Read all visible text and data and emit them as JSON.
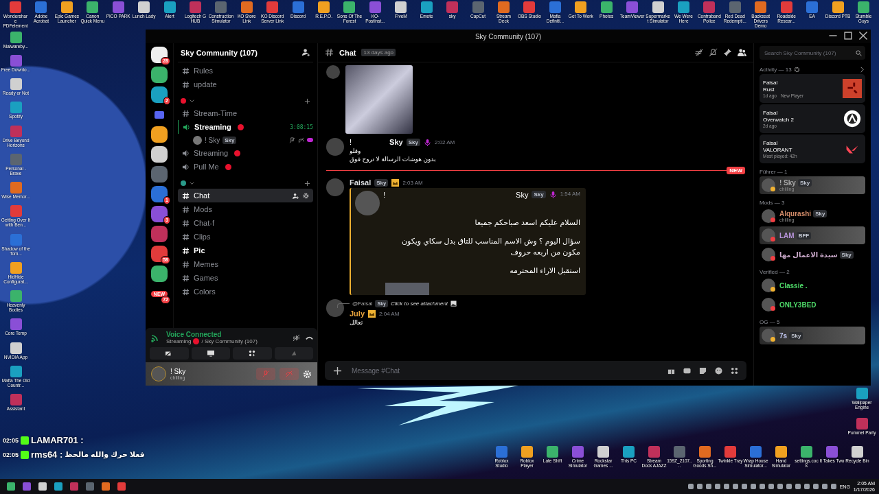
{
  "desktop": {
    "top_icons": [
      "Wondershare PDFelement",
      "Adobe Acrobat",
      "Epic Games Launcher",
      "Canon Quick Menu",
      "PICO PARK",
      "Lunch Lady",
      "Alert",
      "Logitech G HUB",
      "Construction Simulator",
      "KO Store Link",
      "KO Discord Server Link",
      "Discord",
      "R.E.P.O.",
      "Sons Of The Forest",
      "KO-Postinst...",
      "FiveM",
      "Emote",
      "sky",
      "CapCut",
      "Stream Deck",
      "OBS Studio",
      "Mafia Definiti...",
      "Get To Work",
      "Photos",
      "TeamViewer",
      "Supermarket Simulator",
      "We Were Here",
      "Contraband Police",
      "Red Dead Redempti...",
      "Backseat Drivers Demo",
      "Roadside Resear...",
      "EA",
      "Discord PTB",
      "Stumble Guys"
    ],
    "left_icons": [
      "Malwareby...",
      "Free Downlo...",
      "Ready or Not",
      "Spotify",
      "Drive Beyond Horizons",
      "Personal - Brave",
      "Wise Memor...",
      "Getting Over It with Ben...",
      "Shadow of the Tom...",
      "HidHide Configurat...",
      "Heavenly Bodies",
      "Core Temp",
      "NVIDIA App",
      "Mafia The Old Countr...",
      "Assistant"
    ],
    "right_icons": [
      "Wallpaper Engine",
      "Pummel Party"
    ],
    "bottom_icons": [
      "Roblox Studio",
      "Roblox Player",
      "Late Shift",
      "Crime Simulator",
      "Rockstar Games ...",
      "This PC",
      "Stream Dock AJAZZ",
      "159Z_2107....",
      "Sporting Goods Sh...",
      "Twinkle Tray",
      "Wrap House Simulator...",
      "Hand Simulator",
      "settings.cock",
      "It Takes Two",
      "Recycle Bin"
    ]
  },
  "stream_overlay": [
    {
      "time": "02:05",
      "user": "LAMAR701 :"
    },
    {
      "time": "02:05",
      "user": "rms64 :",
      "text": "فعلا حرك والله مالحظ"
    }
  ],
  "window": {
    "title": "Sky Community (107)"
  },
  "servers": [
    {
      "kind": "home",
      "badge": "28"
    },
    {
      "kind": "server"
    },
    {
      "kind": "server",
      "badge": "2"
    },
    {
      "kind": "folder"
    },
    {
      "kind": "server"
    },
    {
      "kind": "server"
    },
    {
      "kind": "server"
    },
    {
      "kind": "server",
      "badge": "1"
    },
    {
      "kind": "server",
      "badge": "3"
    },
    {
      "kind": "server"
    },
    {
      "kind": "server",
      "badge": "58"
    },
    {
      "kind": "server"
    },
    {
      "kind": "new",
      "label": "NEW",
      "badge": "72"
    }
  ],
  "server_name": "Sky Community (107)",
  "channels": [
    {
      "kind": "text",
      "name": "Rules",
      "selected": false,
      "unread": false
    },
    {
      "kind": "text",
      "name": "update",
      "selected": false,
      "unread": false
    },
    {
      "kind": "category",
      "color": "#e8112d"
    },
    {
      "kind": "text",
      "name": "Stream-Time",
      "selected": false,
      "unread": false
    },
    {
      "kind": "voice",
      "name": "Streaming",
      "live": true,
      "active": true,
      "timer": "3:08:15",
      "users": [
        {
          "name": "! Sky",
          "tag": "Sky"
        }
      ]
    },
    {
      "kind": "voice",
      "name": "Streaming",
      "live": true,
      "active": false
    },
    {
      "kind": "voice",
      "name": "Pull Me",
      "live": true,
      "active": false
    },
    {
      "kind": "category",
      "color": "#2a9a8a"
    },
    {
      "kind": "text",
      "name": "Chat",
      "selected": true,
      "unread": false
    },
    {
      "kind": "text",
      "name": "Mods",
      "selected": false,
      "unread": false
    },
    {
      "kind": "text",
      "name": "Chat-f",
      "selected": false,
      "unread": false
    },
    {
      "kind": "text",
      "name": "Clips",
      "selected": false,
      "unread": false
    },
    {
      "kind": "text",
      "name": "Pic",
      "selected": false,
      "unread": true
    },
    {
      "kind": "text",
      "name": "Memes",
      "selected": false,
      "unread": false
    },
    {
      "kind": "text",
      "name": "Games",
      "selected": false,
      "unread": false
    },
    {
      "kind": "text",
      "name": "Colors",
      "selected": false,
      "unread": false
    }
  ],
  "voice_panel": {
    "title": "Voice Connected",
    "channel": "Streaming",
    "server": "/ Sky Community (107)"
  },
  "user_panel": {
    "name": "! Sky",
    "status": "chilling"
  },
  "chat_header": {
    "channel": "Chat",
    "topic": "13 days ago"
  },
  "messages": [
    {
      "kind": "image"
    },
    {
      "kind": "message",
      "prefix": "!",
      "author": "Sky",
      "color": "#f2f3f5",
      "tag": "Sky",
      "mic": true,
      "time": "2:02 AM",
      "lines": [
        "وقلو",
        "بدون هوشات الرسالة لا تروح فوق"
      ]
    },
    {
      "kind": "divider",
      "label": "NEW"
    },
    {
      "kind": "embed",
      "author": "Faisal",
      "color": "#dbdee1",
      "tag": "Sky",
      "crown": true,
      "time": "2:03 AM",
      "embed": {
        "prefix": "!",
        "author": "Sky",
        "tag": "Sky",
        "mic": true,
        "time": "1:54 AM",
        "paragraphs": [
          "السلام عليكم اسعد صباحكم جميعا",
          "سؤال اليوم ؟ وش الاسم المناسب للتاق بدل سكاي ويكون مكون من اربعه حروف",
          "استقبل الاراء المحترمه"
        ]
      }
    },
    {
      "kind": "reply",
      "reply": {
        "mention": "@Faisal",
        "tag": "Sky",
        "text": "Click to see attachment"
      },
      "author": "July",
      "color": "#e8a33c",
      "crown": true,
      "time": "2:04 AM",
      "lines": [
        "تعالل"
      ]
    }
  ],
  "message_input": {
    "placeholder": "Message #Chat"
  },
  "search": {
    "placeholder": "Search Sky Community (107)"
  },
  "activity": {
    "title": "Activity — 13",
    "cards": [
      {
        "kind": "rust",
        "user": "Faisal",
        "game": "Rust",
        "meta": "1d ago",
        "extra": "New Player"
      },
      {
        "kind": "overwatch",
        "user": "Faisal",
        "game": "Overwatch 2",
        "meta": "2d ago"
      },
      {
        "kind": "valorant",
        "user": "Faisal",
        "game": "VALORANT",
        "meta": "Most played: 42h"
      }
    ]
  },
  "member_groups": [
    {
      "title": "Führer — 1",
      "members": [
        {
          "kind": "idle",
          "name": "! Sky",
          "tag": "Sky",
          "status": "chilling",
          "color": "#a8a8a8",
          "highlighted": true
        }
      ]
    },
    {
      "title": "Mods — 3",
      "members": [
        {
          "kind": "dnd",
          "name": "Alqurashi",
          "tag": "Sky",
          "status": "chilling",
          "color": "#d08a68",
          "highlighted": false
        },
        {
          "kind": "dnd",
          "name": "LAM",
          "tag": "BFF",
          "color": "#b592d8",
          "highlighted": true
        },
        {
          "kind": "dnd",
          "name": "سيدة الاعمال مها",
          "tag": "Sky",
          "color": "#c9a8c9",
          "highlighted": false
        }
      ]
    },
    {
      "title": "Verified — 2",
      "members": [
        {
          "kind": "idle",
          "name": "Classie .",
          "color": "#4fdc6a",
          "highlighted": false
        },
        {
          "kind": "dnd",
          "name": "ONLY3BED",
          "color": "#4fdc6a",
          "highlighted": false
        }
      ]
    },
    {
      "title": "OG — 5",
      "members": [
        {
          "kind": "idle",
          "name": "7s",
          "tag": "Sky",
          "color": "#c4c9f5",
          "highlighted": true
        }
      ]
    }
  ],
  "taskbar": {
    "language": "ENG",
    "time": "2:05 AM",
    "date": "1/17/2026"
  }
}
